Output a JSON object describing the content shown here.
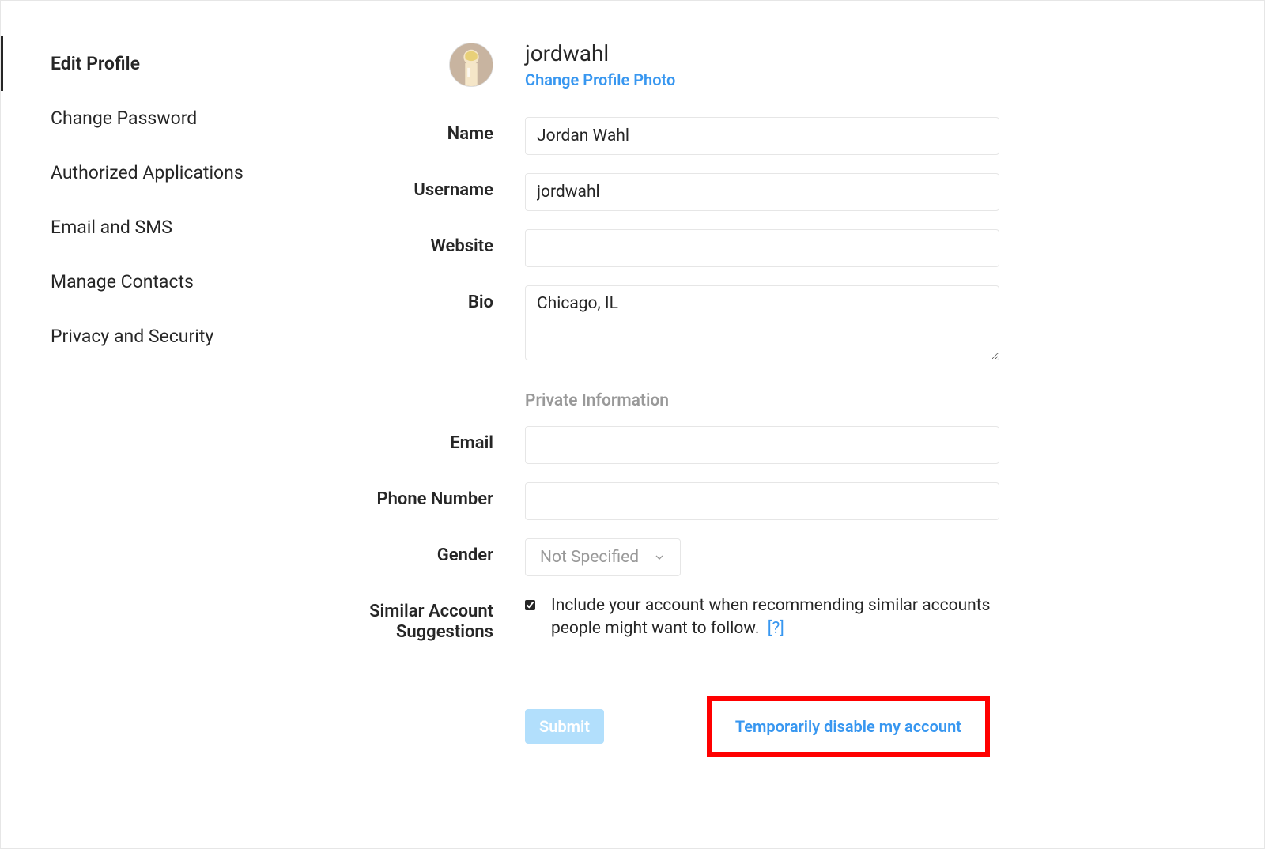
{
  "sidebar": {
    "items": [
      {
        "label": "Edit Profile",
        "active": true
      },
      {
        "label": "Change Password",
        "active": false
      },
      {
        "label": "Authorized Applications",
        "active": false
      },
      {
        "label": "Email and SMS",
        "active": false
      },
      {
        "label": "Manage Contacts",
        "active": false
      },
      {
        "label": "Privacy and Security",
        "active": false
      }
    ]
  },
  "profile": {
    "username": "jordwahl",
    "change_photo_label": "Change Profile Photo"
  },
  "form": {
    "name": {
      "label": "Name",
      "value": "Jordan Wahl"
    },
    "username": {
      "label": "Username",
      "value": "jordwahl"
    },
    "website": {
      "label": "Website",
      "value": ""
    },
    "bio": {
      "label": "Bio",
      "value": "Chicago, IL"
    },
    "private_section_heading": "Private Information",
    "email": {
      "label": "Email",
      "value": ""
    },
    "phone": {
      "label": "Phone Number",
      "value": ""
    },
    "gender": {
      "label": "Gender",
      "value": "Not Specified"
    },
    "similar": {
      "label": "Similar Account Suggestions",
      "checked": true,
      "text": "Include your account when recommending similar accounts people might want to follow.",
      "help": "[?]"
    }
  },
  "actions": {
    "submit_label": "Submit",
    "disable_label": "Temporarily disable my account"
  },
  "colors": {
    "link": "#3897f0",
    "highlight_border": "#ff0000",
    "submit_bg": "#b2dffc"
  }
}
